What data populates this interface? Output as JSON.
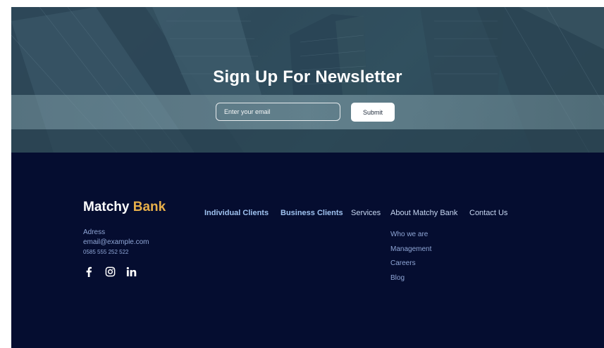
{
  "newsletter": {
    "title": "Sign Up For Newsletter",
    "email_placeholder": "Enter your email",
    "submit_label": "Submit"
  },
  "footer": {
    "brand": {
      "name_part1": "Matchy",
      "name_part2": "Bank",
      "accent_color": "#e8b04a"
    },
    "contact": {
      "address": "Adress",
      "email": "email@example.com",
      "phone": "0585 555 252 522"
    },
    "social": [
      {
        "icon": "facebook-icon",
        "glyph": "f"
      },
      {
        "icon": "instagram-icon",
        "glyph": "ig"
      },
      {
        "icon": "linkedin-icon",
        "glyph": "in"
      }
    ],
    "nav": {
      "individual_clients": "Individual Clients",
      "business_clients": "Business Clients",
      "services": "Services",
      "about": "About Matchy Bank",
      "contact_us": "Contact Us"
    },
    "about_submenu": [
      "Who we are",
      "Management",
      "Careers",
      "Blog"
    ],
    "background_color": "#050d30"
  }
}
